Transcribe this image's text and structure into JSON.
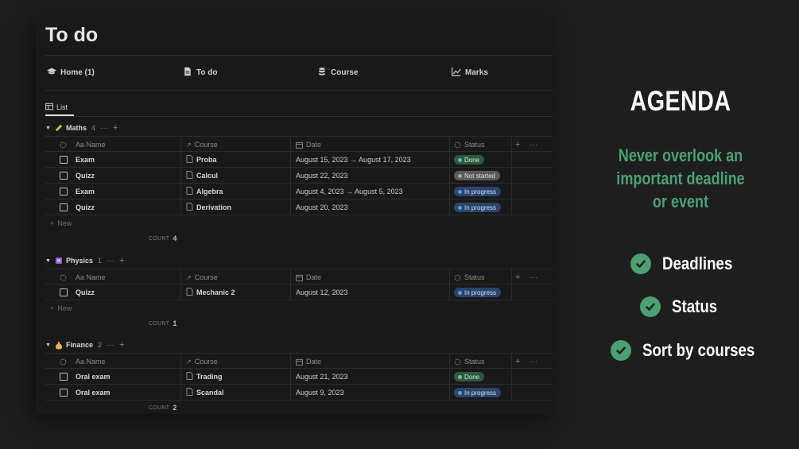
{
  "page": {
    "title": "To do"
  },
  "nav": [
    {
      "label": "Home (1)",
      "icon": "graduation-cap-icon"
    },
    {
      "label": "To do",
      "icon": "document-icon"
    },
    {
      "label": "Course",
      "icon": "database-icon"
    },
    {
      "label": "Marks",
      "icon": "chart-icon"
    }
  ],
  "view_tab": {
    "label": "List",
    "icon": "table-icon"
  },
  "columns": {
    "name": "Aa Name",
    "course": "Course",
    "date": "Date",
    "status": "Status"
  },
  "new_label": "New",
  "count_label": "COUNT",
  "groups": [
    {
      "name": "Maths",
      "count": "4",
      "icon": "ruler-icon",
      "count_value": "4",
      "rows": [
        {
          "name": "Exam",
          "course": "Proba",
          "date": "August 15, 2023 → August 17, 2023",
          "status": "Done"
        },
        {
          "name": "Quizz",
          "course": "Calcul",
          "date": "August 22, 2023",
          "status": "Not started"
        },
        {
          "name": "Exam",
          "course": "Algebra",
          "date": "August 4, 2023 → August 5, 2023",
          "status": "In progress"
        },
        {
          "name": "Quizz",
          "course": "Derivation",
          "date": "August 20, 2023",
          "status": "In progress"
        }
      ]
    },
    {
      "name": "Physics",
      "count": "1",
      "icon": "square-icon",
      "count_value": "1",
      "rows": [
        {
          "name": "Quizz",
          "course": "Mechanic 2",
          "date": "August 12, 2023",
          "status": "In progress"
        }
      ]
    },
    {
      "name": "Finance",
      "count": "2",
      "icon": "money-bag-icon",
      "count_value": "2",
      "rows": [
        {
          "name": "Oral exam",
          "course": "Trading",
          "date": "August 21, 2023",
          "status": "Done"
        },
        {
          "name": "Oral exam",
          "course": "Scandal",
          "date": "August 9, 2023",
          "status": "In progress"
        }
      ]
    }
  ],
  "promo": {
    "title": "AGENDA",
    "tagline": "Never overlook an important deadline or event",
    "features": [
      "Deadlines",
      "Status",
      "Sort by courses"
    ]
  },
  "colors": {
    "background": "#1e1e1e",
    "panel": "#191919",
    "accent_green": "#4aa272",
    "status_done": "#2b5b3f",
    "status_not_started": "#5a5a5a",
    "status_in_progress": "#28456c"
  }
}
